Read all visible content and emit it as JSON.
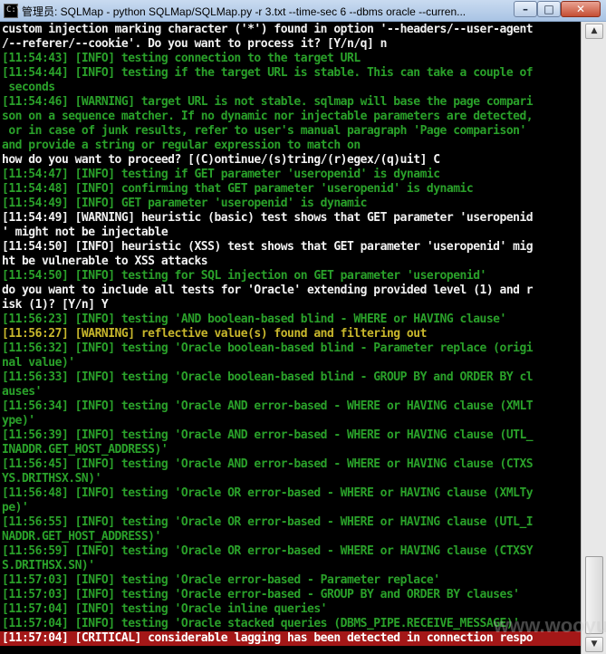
{
  "window": {
    "title": "管理员: SQLMap - python  SQLMap/SQLMap.py -r 3.txt --time-sec 6 --dbms oracle --curren...",
    "icon": "cmd-console-icon",
    "controls": {
      "minimize": "–",
      "maximize": "□",
      "close": "✕"
    }
  },
  "scrollbar": {
    "up": "▲",
    "down": "▼",
    "position": 0.98
  },
  "console": {
    "lines": [
      {
        "text": "custom injection marking character ('*') found in option '--headers/--user-agent",
        "kind": "white"
      },
      {
        "text": "/--referer/--cookie'. Do you want to process it? [Y/n/q] n",
        "kind": "white"
      },
      {
        "text": "[11:54:43] [INFO] testing connection to the target URL",
        "kind": "green"
      },
      {
        "text": "[11:54:44] [INFO] testing if the target URL is stable. This can take a couple of",
        "kind": "green"
      },
      {
        "text": " seconds",
        "kind": "green"
      },
      {
        "text": "[11:54:46] [WARNING] target URL is not stable. sqlmap will base the page compari",
        "kind": "green"
      },
      {
        "text": "son on a sequence matcher. If no dynamic nor injectable parameters are detected,",
        "kind": "green"
      },
      {
        "text": " or in case of junk results, refer to user's manual paragraph 'Page comparison'",
        "kind": "green"
      },
      {
        "text": "and provide a string or regular expression to match on",
        "kind": "green"
      },
      {
        "text": "how do you want to proceed? [(C)ontinue/(s)tring/(r)egex/(q)uit] C",
        "kind": "white"
      },
      {
        "text": "[11:54:47] [INFO] testing if GET parameter 'useropenid' is dynamic",
        "kind": "green"
      },
      {
        "text": "[11:54:48] [INFO] confirming that GET parameter 'useropenid' is dynamic",
        "kind": "green"
      },
      {
        "text": "[11:54:49] [INFO] GET parameter 'useropenid' is dynamic",
        "kind": "green"
      },
      {
        "text": "[11:54:49] [WARNING] heuristic (basic) test shows that GET parameter 'useropenid",
        "kind": "white"
      },
      {
        "text": "' might not be injectable",
        "kind": "white"
      },
      {
        "text": "[11:54:50] [INFO] heuristic (XSS) test shows that GET parameter 'useropenid' mig",
        "kind": "white"
      },
      {
        "text": "ht be vulnerable to XSS attacks",
        "kind": "white"
      },
      {
        "text": "[11:54:50] [INFO] testing for SQL injection on GET parameter 'useropenid'",
        "kind": "green"
      },
      {
        "text": "do you want to include all tests for 'Oracle' extending provided level (1) and r",
        "kind": "white"
      },
      {
        "text": "isk (1)? [Y/n] Y",
        "kind": "white"
      },
      {
        "text": "[11:56:23] [INFO] testing 'AND boolean-based blind - WHERE or HAVING clause'",
        "kind": "green"
      },
      {
        "text": "[11:56:27] [WARNING] reflective value(s) found and filtering out",
        "kind": "yellow"
      },
      {
        "text": "[11:56:32] [INFO] testing 'Oracle boolean-based blind - Parameter replace (origi",
        "kind": "green"
      },
      {
        "text": "nal value)'",
        "kind": "green"
      },
      {
        "text": "[11:56:33] [INFO] testing 'Oracle boolean-based blind - GROUP BY and ORDER BY cl",
        "kind": "green"
      },
      {
        "text": "auses'",
        "kind": "green"
      },
      {
        "text": "[11:56:34] [INFO] testing 'Oracle AND error-based - WHERE or HAVING clause (XMLT",
        "kind": "green"
      },
      {
        "text": "ype)'",
        "kind": "green"
      },
      {
        "text": "[11:56:39] [INFO] testing 'Oracle AND error-based - WHERE or HAVING clause (UTL_",
        "kind": "green"
      },
      {
        "text": "INADDR.GET_HOST_ADDRESS)'",
        "kind": "green"
      },
      {
        "text": "[11:56:45] [INFO] testing 'Oracle AND error-based - WHERE or HAVING clause (CTXS",
        "kind": "green"
      },
      {
        "text": "YS.DRITHSX.SN)'",
        "kind": "green"
      },
      {
        "text": "[11:56:48] [INFO] testing 'Oracle OR error-based - WHERE or HAVING clause (XMLTy",
        "kind": "green"
      },
      {
        "text": "pe)'",
        "kind": "green"
      },
      {
        "text": "[11:56:55] [INFO] testing 'Oracle OR error-based - WHERE or HAVING clause (UTL_I",
        "kind": "green"
      },
      {
        "text": "NADDR.GET_HOST_ADDRESS)'",
        "kind": "green"
      },
      {
        "text": "[11:56:59] [INFO] testing 'Oracle OR error-based - WHERE or HAVING clause (CTXSY",
        "kind": "green"
      },
      {
        "text": "S.DRITHSX.SN)'",
        "kind": "green"
      },
      {
        "text": "[11:57:03] [INFO] testing 'Oracle error-based - Parameter replace'",
        "kind": "green"
      },
      {
        "text": "[11:57:03] [INFO] testing 'Oracle error-based - GROUP BY and ORDER BY clauses'",
        "kind": "green"
      },
      {
        "text": "[11:57:04] [INFO] testing 'Oracle inline queries'",
        "kind": "green"
      },
      {
        "text": "[11:57:04] [INFO] testing 'Oracle stacked queries (DBMS_PIPE.RECEIVE_MESSAGE)'",
        "kind": "green"
      },
      {
        "text": "[11:57:04] [CRITICAL] considerable lagging has been detected in connection respo",
        "kind": "critical"
      }
    ]
  },
  "watermark": "www.wooyun.org"
}
